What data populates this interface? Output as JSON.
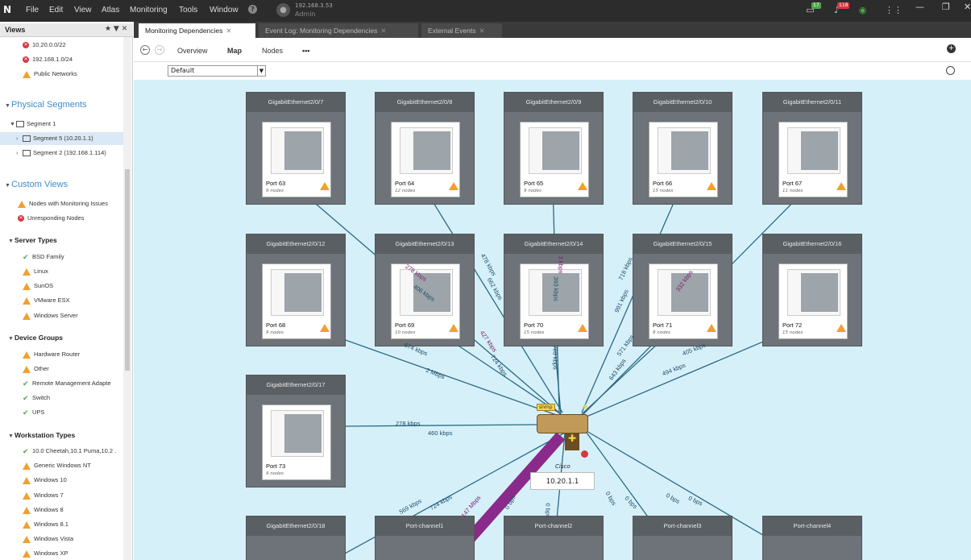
{
  "titlebar": {
    "menus": [
      "File",
      "Edit",
      "View",
      "Atlas",
      "Monitoring",
      "Tools",
      "Window"
    ],
    "help": "?",
    "user_ip": "192.168.3.53",
    "user_role": "Admin",
    "notif_count_1": "17",
    "notif_count_2": "118"
  },
  "views": {
    "title": "Views",
    "tools": "★ ▼ ✕",
    "items": [
      {
        "icon": "error",
        "label": "10.20.0.0/22"
      },
      {
        "icon": "error",
        "label": "192.168.1.0/24"
      },
      {
        "icon": "warn",
        "label": "Public Networks"
      }
    ],
    "physical_segments": {
      "header": "Physical Segments",
      "items": [
        {
          "label": "Segment 1"
        },
        {
          "label": "Segment 5 (10.20.1.1)"
        },
        {
          "label": "Segment 2 (192.168.1.114)"
        }
      ]
    },
    "custom_views": {
      "header": "Custom Views",
      "items": [
        {
          "icon": "warn",
          "label": "Nodes with Monitoring Issues"
        },
        {
          "icon": "error",
          "label": "Unresponding Nodes"
        }
      ]
    },
    "server_types": {
      "header": "Server Types",
      "items": [
        {
          "icon": "ok",
          "label": "BSD Family"
        },
        {
          "icon": "warn",
          "label": "Linux"
        },
        {
          "icon": "warn",
          "label": "SunOS"
        },
        {
          "icon": "warn",
          "label": "VMware ESX"
        },
        {
          "icon": "warn",
          "label": "Windows Server"
        }
      ]
    },
    "device_groups": {
      "header": "Device Groups",
      "items": [
        {
          "icon": "warn",
          "label": "Hardware Router"
        },
        {
          "icon": "warn",
          "label": "Other"
        },
        {
          "icon": "ok",
          "label": "Remote Management Adapte"
        },
        {
          "icon": "ok",
          "label": "Switch"
        },
        {
          "icon": "ok",
          "label": "UPS"
        }
      ]
    },
    "workstation_types": {
      "header": "Workstation Types",
      "items": [
        {
          "icon": "ok",
          "label": "10.0 Cheetah,10.1 Puma,10.2 ."
        },
        {
          "icon": "warn",
          "label": "Generic Windows NT"
        },
        {
          "icon": "warn",
          "label": "Windows 10"
        },
        {
          "icon": "warn",
          "label": "Windows 7"
        },
        {
          "icon": "warn",
          "label": "Windows 8"
        },
        {
          "icon": "warn",
          "label": "Windows 8.1"
        },
        {
          "icon": "warn",
          "label": "Windows Vista"
        },
        {
          "icon": "warn",
          "label": "Windows XP"
        }
      ]
    }
  },
  "tabs": [
    {
      "label": "Monitoring Dependencies",
      "close": "✕",
      "active": true
    },
    {
      "label": "Event Log: Monitoring Dependencies",
      "close": "✕",
      "active": false
    },
    {
      "label": "External Events",
      "close": "✕",
      "active": false
    }
  ],
  "toolbar": {
    "overview": "Overview",
    "map": "Map",
    "nodes": "Nodes",
    "more": "•••",
    "view_select": "Default",
    "add": "+"
  },
  "map": {
    "nodes": [
      {
        "title": "GigabitEthernet2/0/7",
        "port": "Port 63",
        "count": "9 nodes"
      },
      {
        "title": "GigabitEthernet2/0/8",
        "port": "Port 64",
        "count": "12 nodes"
      },
      {
        "title": "GigabitEthernet2/0/9",
        "port": "Port 65",
        "count": "9 nodes"
      },
      {
        "title": "GigabitEthernet2/0/10",
        "port": "Port 66",
        "count": "15 nodes"
      },
      {
        "title": "GigabitEthernet2/0/11",
        "port": "Port 67",
        "count": "11 nodes"
      },
      {
        "title": "GigabitEthernet2/0/12",
        "port": "Port 68",
        "count": "9 nodes"
      },
      {
        "title": "GigabitEthernet2/0/13",
        "port": "Port 69",
        "count": "10 nodes"
      },
      {
        "title": "GigabitEthernet2/0/14",
        "port": "Port 70",
        "count": "15 nodes"
      },
      {
        "title": "GigabitEthernet2/0/15",
        "port": "Port 71",
        "count": "8 nodes"
      },
      {
        "title": "GigabitEthernet2/0/16",
        "port": "Port 72",
        "count": "15 nodes"
      },
      {
        "title": "GigabitEthernet2/0/17",
        "port": "Port 73",
        "count": "9 nodes"
      },
      {
        "title": "GigabitEthernet2/0/18",
        "port": "",
        "count": ""
      },
      {
        "title": "Port-channel1",
        "port": "",
        "count": ""
      },
      {
        "title": "Port-channel2",
        "port": "",
        "count": ""
      },
      {
        "title": "Port-channel3",
        "port": "",
        "count": ""
      },
      {
        "title": "Port-channel4",
        "port": "",
        "count": ""
      }
    ],
    "router": {
      "badge": "snmp",
      "vendor": "Cisco",
      "ip": "10.20.1.1"
    },
    "link_labels": [
      "478 kbps",
      "662 kbps",
      "3 kbps",
      "393 kbps",
      "718 kbps",
      "991 kbps",
      "278 kbps",
      "406 kbps",
      "427 kbps",
      "724 kbps",
      "703 kbps",
      "571 kbps",
      "643 kbps",
      "332 kbps",
      "674 kbps",
      "2 Mbps",
      "405 kbps",
      "494 kbps",
      "278 kbps",
      "460 kbps",
      "569 kbps",
      "724 kbps",
      "147 Mbps",
      "0 bps",
      "0 bps",
      "0 bps",
      "0 bps",
      "0 bps",
      "0 bps"
    ]
  }
}
